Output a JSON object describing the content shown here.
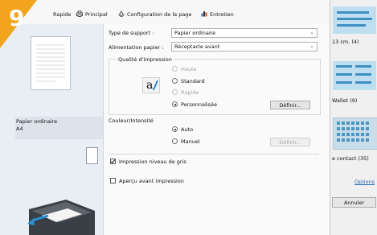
{
  "step_badge": "9",
  "tabs": [
    {
      "label": "Rapide",
      "icon": "quick-icon"
    },
    {
      "label": "Principal",
      "icon": "printer-icon"
    },
    {
      "label": "Configuration de la page",
      "icon": "page-setup-icon"
    },
    {
      "label": "Entretien",
      "icon": "maintenance-icon"
    }
  ],
  "left": {
    "paper_type": "Papier ordinaire",
    "paper_size": "A4"
  },
  "settings": {
    "media_type_label": "Type de support :",
    "media_type_value": "Papier ordinaire",
    "paper_source_label": "Alimentation papier :",
    "paper_source_value": "Réceptacle avant",
    "print_quality_label": "Qualité d'impression",
    "quality_options": [
      "Haute",
      "Standard",
      "Rapide",
      "Personnalisée"
    ],
    "quality_selected": "Personnalisée",
    "define_button": "Définir...",
    "color_label": "Couleur/Intensité",
    "color_options": [
      "Auto",
      "Manuel"
    ],
    "color_selected": "Auto",
    "color_define_button": "Définir...",
    "grayscale_label": "Impression niveau de gris",
    "grayscale_checked": true,
    "preview_label": "Aperçu avant impression",
    "preview_checked": false
  },
  "right": {
    "item1": "13 cm. (4)",
    "item2": "Wallet (9)",
    "item3": "e contact (35)",
    "options_link": "Options",
    "cancel_button": "Annuler"
  },
  "colors": {
    "badge": "#f2a51c",
    "thumb": "#3f8fc2"
  }
}
